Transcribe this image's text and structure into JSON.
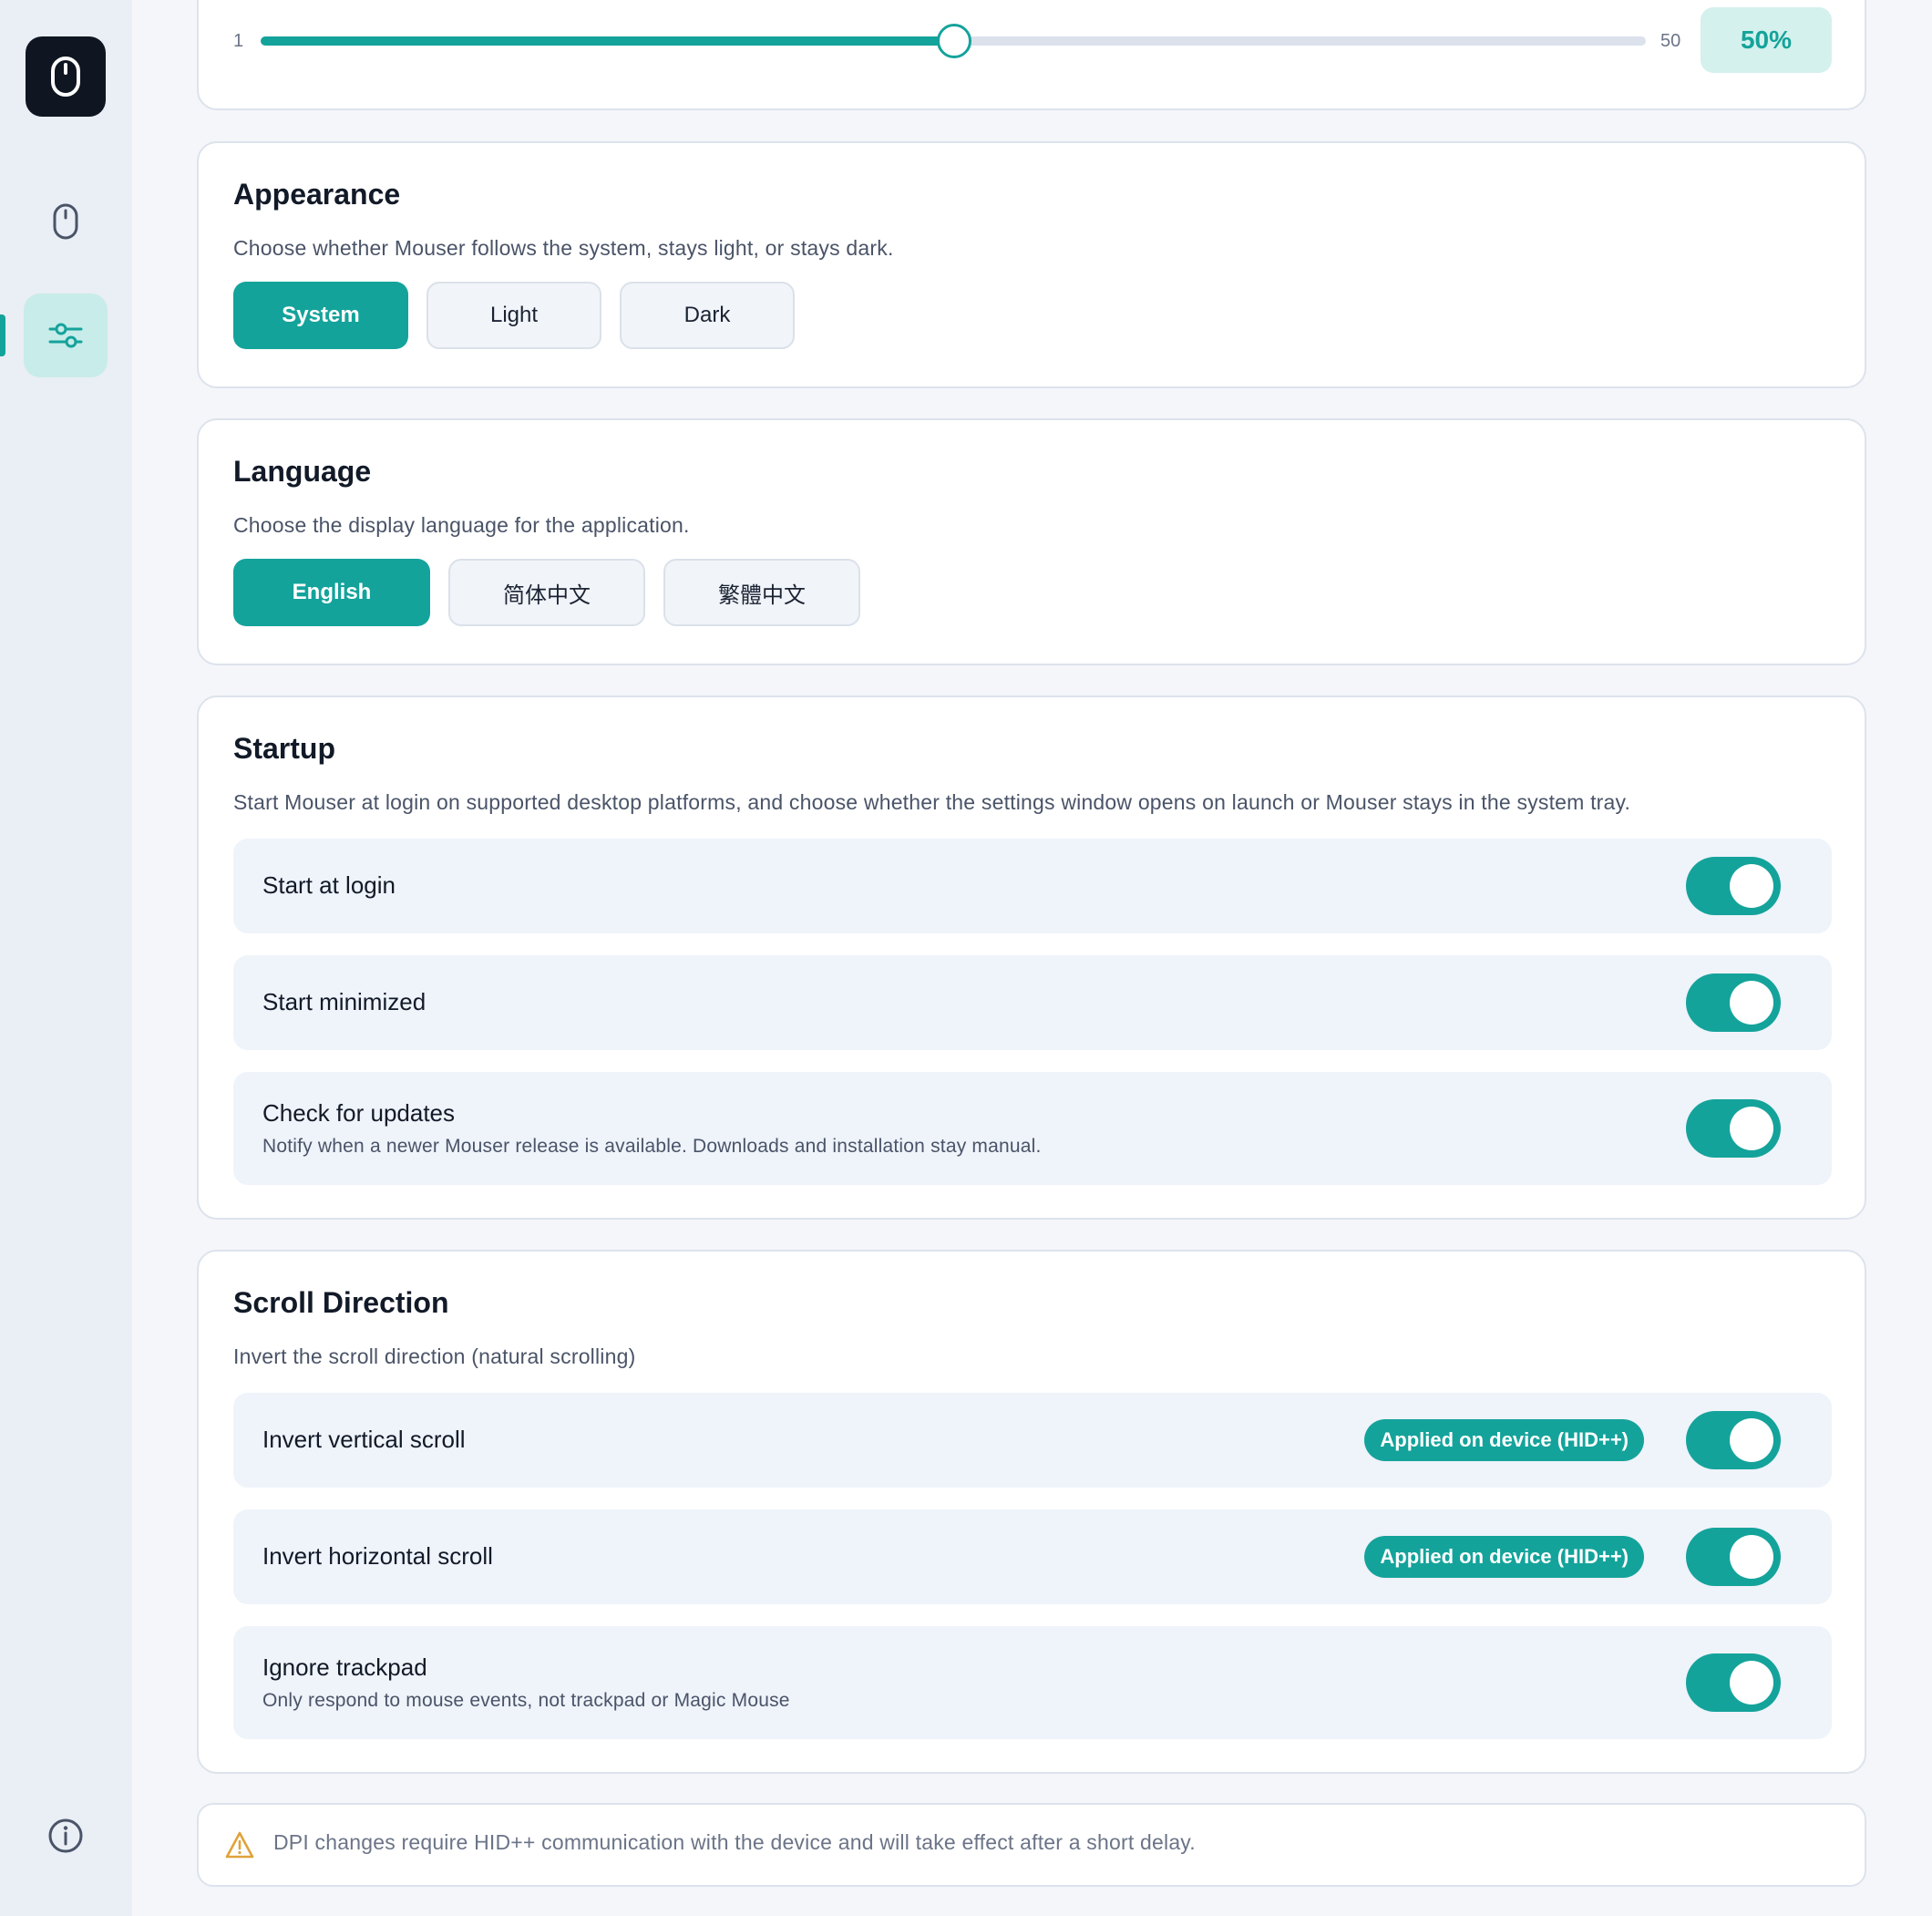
{
  "sidebar": {
    "logo_icon": "mouse-icon",
    "items": [
      {
        "icon": "mouse-icon",
        "active": false
      },
      {
        "icon": "sliders-icon",
        "active": true
      }
    ],
    "footer_icon": "info-icon"
  },
  "scroll_speed": {
    "min_label": "1",
    "max_label": "50",
    "value_percent": 50,
    "value_label": "50%"
  },
  "appearance": {
    "title": "Appearance",
    "description": "Choose whether Mouser follows the system, stays light, or stays dark.",
    "options": [
      "System",
      "Light",
      "Dark"
    ],
    "selected": "System"
  },
  "language": {
    "title": "Language",
    "description": "Choose the display language for the application.",
    "options": [
      "English",
      "简体中文",
      "繁體中文"
    ],
    "selected": "English"
  },
  "startup": {
    "title": "Startup",
    "description": "Start Mouser at login on supported desktop platforms, and choose whether the settings window opens on launch or Mouser stays in the system tray.",
    "rows": [
      {
        "label": "Start at login",
        "enabled": true
      },
      {
        "label": "Start minimized",
        "enabled": true
      },
      {
        "label": "Check for updates",
        "sub": "Notify when a newer Mouser release is available. Downloads and installation stay manual.",
        "enabled": true
      }
    ]
  },
  "scroll_direction": {
    "title": "Scroll Direction",
    "description": "Invert the scroll direction (natural scrolling)",
    "rows": [
      {
        "label": "Invert vertical scroll",
        "badge": "Applied on device (HID++)",
        "enabled": true
      },
      {
        "label": "Invert horizontal scroll",
        "badge": "Applied on device (HID++)",
        "enabled": true
      },
      {
        "label": "Ignore trackpad",
        "sub": "Only respond to mouse events, not trackpad or Magic Mouse",
        "enabled": true
      }
    ]
  },
  "notice": {
    "icon": "warning-icon",
    "text": "DPI changes require HID++ communication with the device and will take effect after a short delay."
  },
  "colors": {
    "accent": "#14a39b",
    "accent_soft": "#d4f1ed",
    "warning": "#e0a23a"
  }
}
